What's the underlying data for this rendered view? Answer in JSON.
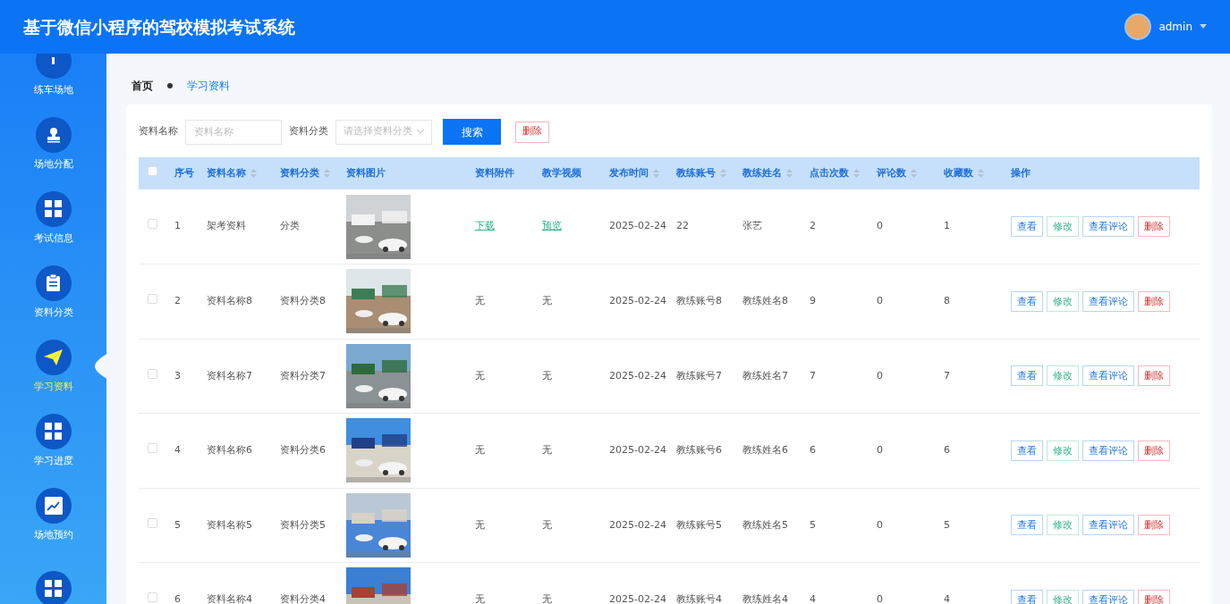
{
  "header": {
    "title": "基于微信小程序的驾校模拟考试系统",
    "user": "admin"
  },
  "sidebar": {
    "items": [
      {
        "label": "练车场地",
        "selected": false
      },
      {
        "label": "场地分配",
        "selected": false
      },
      {
        "label": "考试信息",
        "selected": false
      },
      {
        "label": "资料分类",
        "selected": false
      },
      {
        "label": "学习资料",
        "selected": true
      },
      {
        "label": "学习进度",
        "selected": false
      },
      {
        "label": "场地预约",
        "selected": false
      },
      {
        "selected": false
      }
    ]
  },
  "breadcrumb": [
    "首页",
    "学习资料"
  ],
  "filters": {
    "name_label": "资料名称",
    "name_placeholder": "资料名称",
    "category_label": "资料分类",
    "category_placeholder": "请选择资料分类",
    "search_button": "搜索",
    "delete_button": "删除"
  },
  "table": {
    "select_all_checked": false,
    "columns": [
      {
        "label": "序号",
        "sortable": false
      },
      {
        "label": "资料名称",
        "sortable": true
      },
      {
        "label": "资料分类",
        "sortable": true
      },
      {
        "label": "资料图片",
        "sortable": false
      },
      {
        "label": "资料附件",
        "sortable": false
      },
      {
        "label": "教学视频",
        "sortable": false
      },
      {
        "label": "发布时间",
        "sortable": true
      },
      {
        "label": "教练账号",
        "sortable": true
      },
      {
        "label": "教练姓名",
        "sortable": true
      },
      {
        "label": "点击次数",
        "sortable": true
      },
      {
        "label": "评论数",
        "sortable": true
      },
      {
        "label": "收藏数",
        "sortable": true
      },
      {
        "label": "操作",
        "sortable": false
      }
    ],
    "rows": [
      {
        "checked": false,
        "index": "1",
        "name": "架考资料",
        "category": "分类",
        "attachment": {
          "text": "下载",
          "kind": "link"
        },
        "video": {
          "text": "预览",
          "kind": "link"
        },
        "time": "2025-02-24",
        "account": "22",
        "coach": "张艺",
        "clicks": "2",
        "comments": "0",
        "favorites": "1",
        "actions": [
          {
            "label": "查看",
            "kind": "view"
          },
          {
            "label": "修改",
            "kind": "edit"
          },
          {
            "label": "查看评论",
            "kind": "view"
          },
          {
            "label": "删除",
            "kind": "delete"
          }
        ]
      },
      {
        "checked": false,
        "index": "2",
        "name": "资料名称8",
        "category": "资料分类8",
        "attachment": {
          "text": "无",
          "kind": "text"
        },
        "video": {
          "text": "无",
          "kind": "text"
        },
        "time": "2025-02-24",
        "account": "教练账号8",
        "coach": "教练姓名8",
        "clicks": "9",
        "comments": "0",
        "favorites": "8",
        "actions": [
          {
            "label": "查看",
            "kind": "view"
          },
          {
            "label": "修改",
            "kind": "edit"
          },
          {
            "label": "查看评论",
            "kind": "view"
          },
          {
            "label": "删除",
            "kind": "delete"
          }
        ]
      },
      {
        "checked": false,
        "index": "3",
        "name": "资料名称7",
        "category": "资料分类7",
        "attachment": {
          "text": "无",
          "kind": "text"
        },
        "video": {
          "text": "无",
          "kind": "text"
        },
        "time": "2025-02-24",
        "account": "教练账号7",
        "coach": "教练姓名7",
        "clicks": "7",
        "comments": "0",
        "favorites": "7",
        "actions": [
          {
            "label": "查看",
            "kind": "view"
          },
          {
            "label": "修改",
            "kind": "edit"
          },
          {
            "label": "查看评论",
            "kind": "view"
          },
          {
            "label": "删除",
            "kind": "delete"
          }
        ]
      },
      {
        "checked": false,
        "index": "4",
        "name": "资料名称6",
        "category": "资料分类6",
        "attachment": {
          "text": "无",
          "kind": "text"
        },
        "video": {
          "text": "无",
          "kind": "text"
        },
        "time": "2025-02-24",
        "account": "教练账号6",
        "coach": "教练姓名6",
        "clicks": "6",
        "comments": "0",
        "favorites": "6",
        "actions": [
          {
            "label": "查看",
            "kind": "view"
          },
          {
            "label": "修改",
            "kind": "edit"
          },
          {
            "label": "查看评论",
            "kind": "view"
          },
          {
            "label": "删除",
            "kind": "delete"
          }
        ]
      },
      {
        "checked": false,
        "index": "5",
        "name": "资料名称5",
        "category": "资料分类5",
        "attachment": {
          "text": "无",
          "kind": "text"
        },
        "video": {
          "text": "无",
          "kind": "text"
        },
        "time": "2025-02-24",
        "account": "教练账号5",
        "coach": "教练姓名5",
        "clicks": "5",
        "comments": "0",
        "favorites": "5",
        "actions": [
          {
            "label": "查看",
            "kind": "view"
          },
          {
            "label": "修改",
            "kind": "edit"
          },
          {
            "label": "查看评论",
            "kind": "view"
          },
          {
            "label": "删除",
            "kind": "delete"
          }
        ]
      },
      {
        "checked": false,
        "index": "6",
        "name": "资料名称4",
        "category": "资料分类4",
        "attachment": {
          "text": "无",
          "kind": "text"
        },
        "video": {
          "text": "无",
          "kind": "text"
        },
        "time": "2025-02-24",
        "account": "教练账号4",
        "coach": "教练姓名4",
        "clicks": "4",
        "comments": "0",
        "favorites": "4",
        "actions": [
          {
            "label": "查看",
            "kind": "view"
          },
          {
            "label": "修改",
            "kind": "edit"
          },
          {
            "label": "查看评论",
            "kind": "view"
          },
          {
            "label": "删除",
            "kind": "delete"
          }
        ]
      }
    ]
  }
}
